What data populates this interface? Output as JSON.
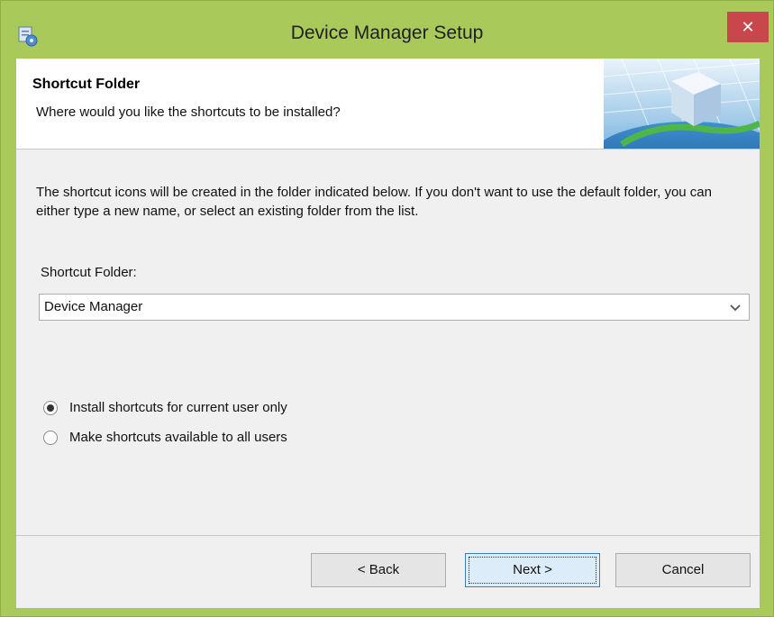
{
  "window": {
    "title": "Device Manager Setup",
    "close_glyph": "✕",
    "icon": "setup-app-icon"
  },
  "header": {
    "title": "Shortcut Folder",
    "subtitle": "Where would you like the shortcuts to be installed?",
    "banner_image": "globe-cube-banner"
  },
  "body": {
    "description": "The shortcut icons will be created in the folder indicated below. If you don't want to use the default folder, you can either type a new name, or select an existing folder from the list.",
    "folder_label": "Shortcut Folder:",
    "folder_value": "Device Manager",
    "options": [
      {
        "label": "Install shortcuts for current user only",
        "selected": true
      },
      {
        "label": "Make shortcuts available to all users",
        "selected": false
      }
    ]
  },
  "buttons": {
    "back": "< Back",
    "next": "Next >",
    "cancel": "Cancel"
  },
  "colors": {
    "titlebar": "#a9c95a",
    "close": "#c9464a",
    "client": "#f0f0f0"
  }
}
